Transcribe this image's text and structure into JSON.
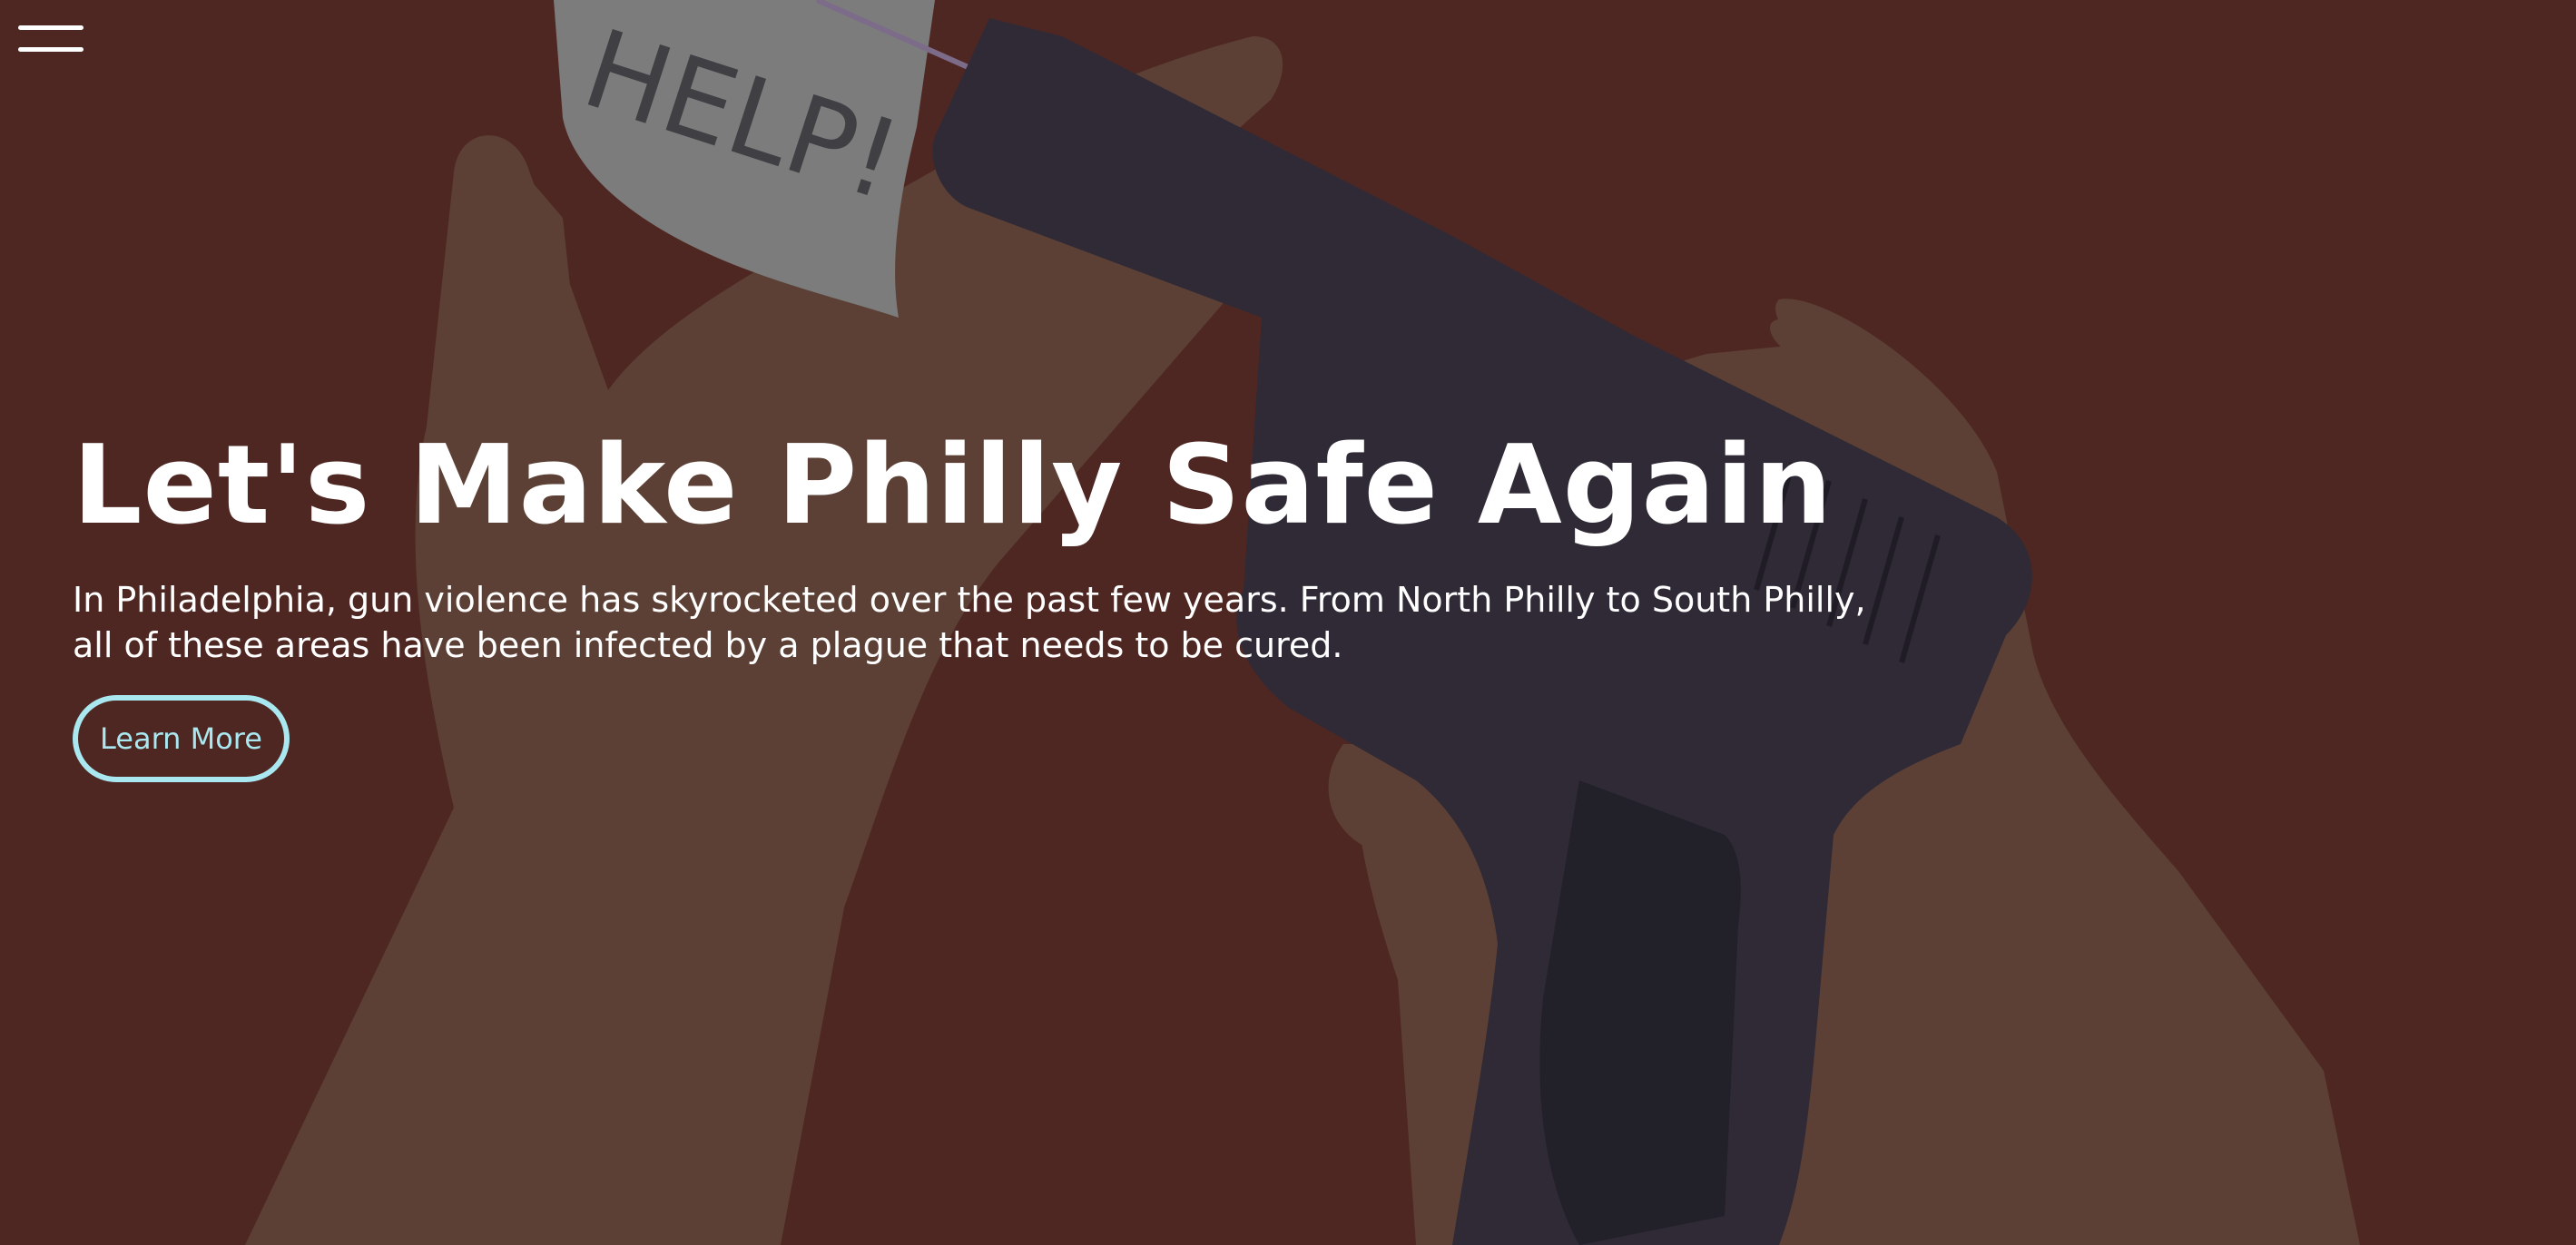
{
  "hero": {
    "headline": "Let's Make Philly Safe Again",
    "subtitle": "In Philadelphia, gun violence has skyrocketed over the past few years. From North Philly to South Philly, all of these areas have been infected by a plague that needs to be cured.",
    "cta_label": "Learn More",
    "note_text": "HELP!"
  },
  "nav": {
    "menu_icon": "hamburger-menu-icon"
  },
  "colors": {
    "background": "#4f2722",
    "accent": "#a9e8f0",
    "text": "#ffffff",
    "skin": "#5c4035",
    "gun": "#2f2a36",
    "note": "#7c7c7c"
  }
}
